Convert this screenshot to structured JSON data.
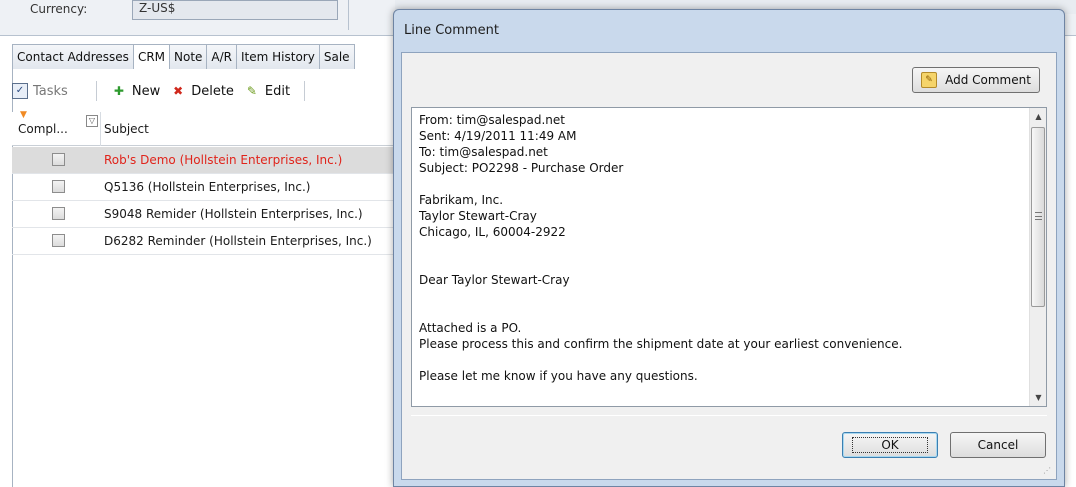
{
  "background": {
    "currency_label": "Currency:",
    "currency_value": "Z-US$",
    "tabs": [
      "Contact Addresses",
      "CRM",
      "Note",
      "A/R",
      "Item History",
      "Sale"
    ],
    "active_tab": "CRM",
    "toolbar": {
      "tasks": "Tasks",
      "new": "New",
      "delete": "Delete",
      "edit": "Edit"
    },
    "grid": {
      "col_completed": "Compl...",
      "col_subject": "Subject",
      "rows": [
        {
          "subject": "Rob's Demo (Hollstein Enterprises, Inc.)",
          "selected": true
        },
        {
          "subject": "Q5136 (Hollstein Enterprises, Inc.)",
          "selected": false
        },
        {
          "subject": "S9048 Remider (Hollstein Enterprises, Inc.)",
          "selected": false
        },
        {
          "subject": "D6282 Reminder (Hollstein Enterprises, Inc.)",
          "selected": false
        }
      ]
    }
  },
  "dialog": {
    "title": "Line Comment",
    "add_comment_label": "Add Comment",
    "ok_label": "OK",
    "cancel_label": "Cancel",
    "body_lines": [
      "From: tim@salespad.net",
      "Sent: 4/19/2011 11:49 AM",
      "To: tim@salespad.net",
      "Subject: PO2298 - Purchase Order",
      "",
      "Fabrikam, Inc.",
      "Taylor Stewart-Cray",
      "Chicago, IL, 60004-2922",
      "",
      "",
      "Dear Taylor Stewart-Cray",
      "",
      "",
      "Attached is a PO.",
      "Please process this and confirm the shipment date at your earliest convenience.",
      "",
      "Please let me know if you have any questions."
    ]
  },
  "colors": {
    "selected_row_text": "#e0241b",
    "dialog_frame": "#c9d9ec"
  }
}
